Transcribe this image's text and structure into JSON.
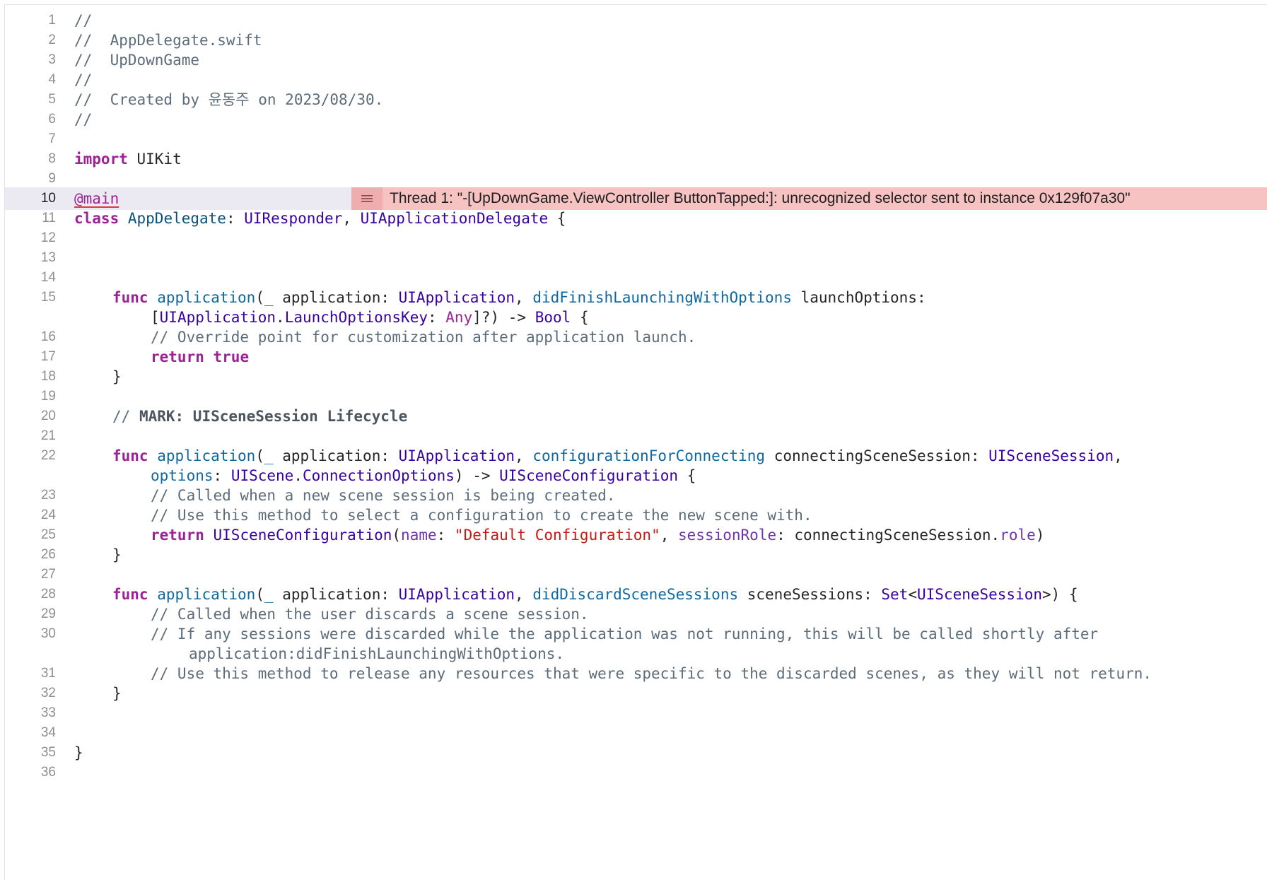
{
  "editor": {
    "file_name": "AppDelegate.swift",
    "current_line": "10",
    "error_message": "Thread 1: \"-[UpDownGame.ViewController ButtonTapped:]: unrecognized selector sent to instance 0x129f07a30\"",
    "error_icon": "list-lines-icon",
    "line_numbers": [
      "1",
      "2",
      "3",
      "4",
      "5",
      "6",
      "7",
      "8",
      "9",
      "10",
      "11",
      "12",
      "13",
      "14",
      "15",
      "16",
      "17",
      "18",
      "19",
      "20",
      "21",
      "22",
      "23",
      "24",
      "25",
      "26",
      "27",
      "28",
      "29",
      "30",
      "31",
      "32",
      "33",
      "34",
      "35",
      "36"
    ],
    "lines": {
      "l1": "//",
      "l2": "//  AppDelegate.swift",
      "l3": "//  UpDownGame",
      "l4": "//",
      "l5": "//  Created by 윤동주 on 2023/08/30.",
      "l6": "//",
      "l8_kw": "import",
      "l8_rest": " UIKit",
      "l10": "@main",
      "l11_kw": "class",
      "l11_name": "AppDelegate",
      "l11_colon": ": ",
      "l11_t1": "UIResponder",
      "l11_comma": ", ",
      "l11_t2": "UIApplicationDelegate",
      "l11_end": " {",
      "l15_kw": "func",
      "l15_fn": "application",
      "l15_p1": "(",
      "l15_us": "_",
      "l15_p2": " application: ",
      "l15_t1": "UIApplication",
      "l15_p3": ", ",
      "l15_lab": "didFinishLaunchingWithOptions",
      "l15_p4": " launchOptions:",
      "l15b_p1": "[",
      "l15b_t1": "UIApplication",
      "l15b_dot": ".",
      "l15b_t2": "LaunchOptionsKey",
      "l15b_p2": ": ",
      "l15b_any": "Any",
      "l15b_p3": "]?) -> ",
      "l15b_t3": "Bool",
      "l15b_end": " {",
      "l16": "// Override point for customization after application launch.",
      "l17_kw1": "return",
      "l17_kw2": "true",
      "l18": "}",
      "l20_c": "// ",
      "l20_mark": "MARK: UISceneSession Lifecycle",
      "l22_kw": "func",
      "l22_fn": "application",
      "l22_p1": "(",
      "l22_us": "_",
      "l22_p2": " application: ",
      "l22_t1": "UIApplication",
      "l22_p3": ", ",
      "l22_lab": "configurationForConnecting",
      "l22_p4": " connectingSceneSession: ",
      "l22_t2": "UISceneSession",
      "l22_p5": ",",
      "l22b_lab": "options",
      "l22b_p1": ": ",
      "l22b_t1": "UIScene",
      "l22b_dot": ".",
      "l22b_t2": "ConnectionOptions",
      "l22b_p2": ") -> ",
      "l22b_t3": "UISceneConfiguration",
      "l22b_end": " {",
      "l23": "// Called when a new scene session is being created.",
      "l24": "// Use this method to select a configuration to create the new scene with.",
      "l25_kw": "return",
      "l25_t1": "UISceneConfiguration",
      "l25_p1": "(",
      "l25_lab1": "name",
      "l25_p2": ": ",
      "l25_str": "\"Default Configuration\"",
      "l25_p3": ", ",
      "l25_lab2": "sessionRole",
      "l25_p4": ": connectingSceneSession.",
      "l25_mem": "role",
      "l25_end": ")",
      "l26": "}",
      "l28_kw": "func",
      "l28_fn": "application",
      "l28_p1": "(",
      "l28_us": "_",
      "l28_p2": " application: ",
      "l28_t1": "UIApplication",
      "l28_p3": ", ",
      "l28_lab": "didDiscardSceneSessions",
      "l28_p4": " sceneSessions: ",
      "l28_t2": "Set",
      "l28_p5": "<",
      "l28_t3": "UISceneSession",
      "l28_end": ">) {",
      "l29": "// Called when the user discards a scene session.",
      "l30": "// If any sessions were discarded while the application was not running, this will be called shortly after",
      "l30b": "application:didFinishLaunchingWithOptions.",
      "l31": "// Use this method to release any resources that were specific to the discarded scenes, as they will not return.",
      "l32": "}",
      "l35": "}"
    }
  }
}
